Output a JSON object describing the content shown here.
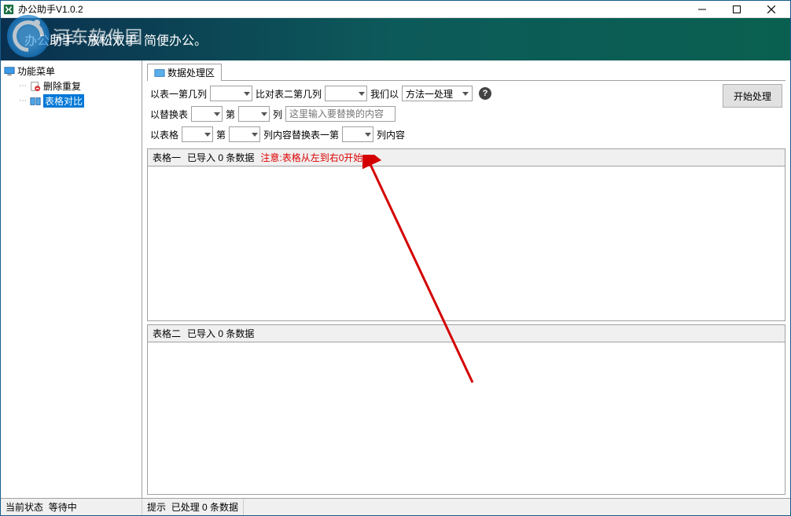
{
  "window": {
    "title": "办公助手V1.0.2"
  },
  "banner": {
    "main": "办公助手---放松双手",
    "sub": "简便办公。"
  },
  "watermark": {
    "text": "河东软件园"
  },
  "sidebar": {
    "root": "功能菜单",
    "items": [
      {
        "label": "删除重复"
      },
      {
        "label": "表格对比"
      }
    ]
  },
  "tab": {
    "label": "数据处理区"
  },
  "controls": {
    "row1": {
      "label1": "以表一第几列",
      "label2": "比对表二第几列",
      "label3": "我们以",
      "method_value": "方法一处理"
    },
    "row2": {
      "label1": "以替换表",
      "label2": "第",
      "label3": "列",
      "input_placeholder": "这里输入要替换的内容"
    },
    "row3": {
      "label1": "以表格",
      "label2": "第",
      "label3": "列内容替换表一第",
      "label4": "列内容"
    }
  },
  "start_button": "开始处理",
  "list1": {
    "title": "表格一",
    "status": "已导入 0 条数据",
    "note": "注意:表格从左到右0开始"
  },
  "list2": {
    "title": "表格二",
    "status": "已导入 0 条数据"
  },
  "statusbar": {
    "state_label": "当前状态",
    "state_value": "等待中",
    "hint_label": "提示",
    "hint_value": "已处理 0 条数据"
  }
}
